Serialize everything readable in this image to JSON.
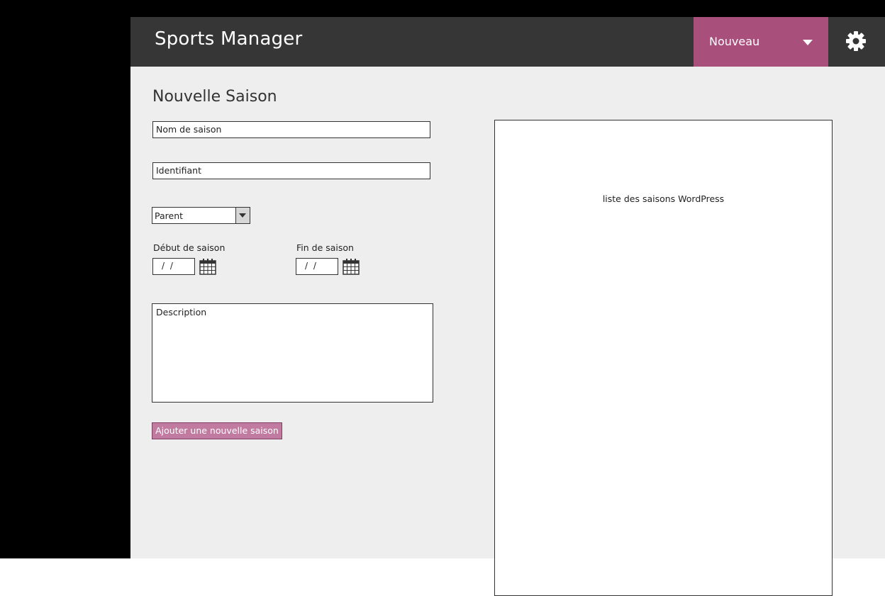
{
  "header": {
    "app_title": "Sports Manager",
    "nouveau_label": "Nouveau",
    "accent_color": "#a94f7c",
    "settings_icon": "gear-icon"
  },
  "form": {
    "page_title": "Nouvelle Saison",
    "season_name_placeholder": "Nom de saison",
    "identifier_placeholder": "Identifiant",
    "parent_select_value": "Parent",
    "start_label": "Début de saison",
    "start_date_value": "/ /",
    "end_label": "Fin de saison",
    "end_date_value": "/ /",
    "description_placeholder": "Description",
    "submit_label": "Ajouter une nouvelle saison"
  },
  "list_panel": {
    "label": "liste des saisons WordPress"
  }
}
